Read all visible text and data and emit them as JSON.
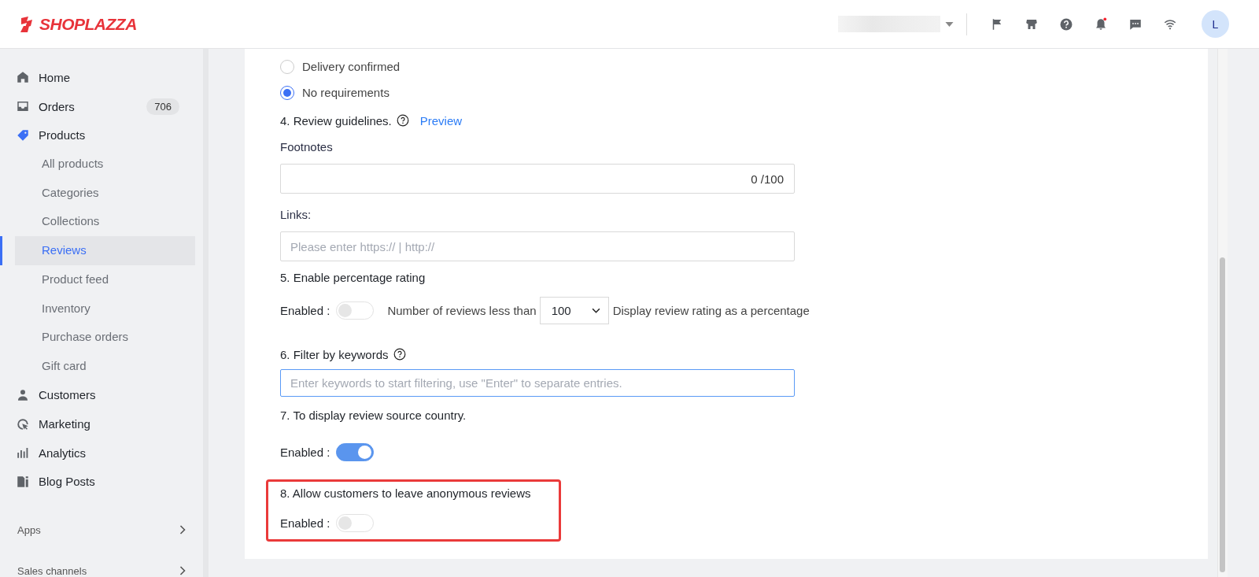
{
  "brand": "SHOPLAZZA",
  "header": {
    "avatar_initial": "L",
    "notification_dot": true
  },
  "sidebar": {
    "nav": [
      {
        "label": "Home",
        "kind": "home",
        "selected": false
      },
      {
        "label": "Orders",
        "kind": "inbox",
        "badge": "706",
        "selected": false
      },
      {
        "label": "Products",
        "kind": "tag",
        "selected": true,
        "children": [
          {
            "label": "All products",
            "selected": false
          },
          {
            "label": "Categories",
            "selected": false
          },
          {
            "label": "Collections",
            "selected": false
          },
          {
            "label": "Reviews",
            "selected": true
          },
          {
            "label": "Product feed",
            "selected": false
          },
          {
            "label": "Inventory",
            "selected": false
          },
          {
            "label": "Purchase orders",
            "selected": false
          },
          {
            "label": "Gift card",
            "selected": false
          }
        ]
      },
      {
        "label": "Customers",
        "kind": "person",
        "selected": false
      },
      {
        "label": "Marketing",
        "kind": "marketing",
        "selected": false
      },
      {
        "label": "Analytics",
        "kind": "chart",
        "selected": false
      },
      {
        "label": "Blog Posts",
        "kind": "blog",
        "selected": false
      }
    ],
    "sections": [
      {
        "label": "Apps"
      },
      {
        "label": "Sales channels"
      }
    ]
  },
  "form": {
    "radio_options": [
      {
        "label": "Delivery confirmed",
        "selected": false
      },
      {
        "label": "No requirements",
        "selected": true
      }
    ],
    "guidelines": {
      "title": "4. Review guidelines.",
      "link": "Preview",
      "footnotes_label": "Footnotes",
      "footnotes_counter": "0 /100",
      "links_label": "Links:",
      "links_placeholder": "Please enter https:// | http://"
    },
    "percentage": {
      "title": "5. Enable percentage rating",
      "enabled_label": "Enabled :",
      "on": false,
      "text_before": "Number of reviews less than",
      "select_value": "100",
      "text_after": "Display review rating as a percentage"
    },
    "keywords": {
      "title": "6. Filter by keywords",
      "placeholder": "Enter keywords to start filtering, use \"Enter\" to separate entries.",
      "focused": true
    },
    "country": {
      "title": "7. To display review source country.",
      "enabled_label": "Enabled :",
      "on": true
    },
    "anonymous": {
      "title": "8. Allow customers to leave anonymous reviews",
      "enabled_label": "Enabled :",
      "on": false,
      "highlighted": true
    }
  }
}
